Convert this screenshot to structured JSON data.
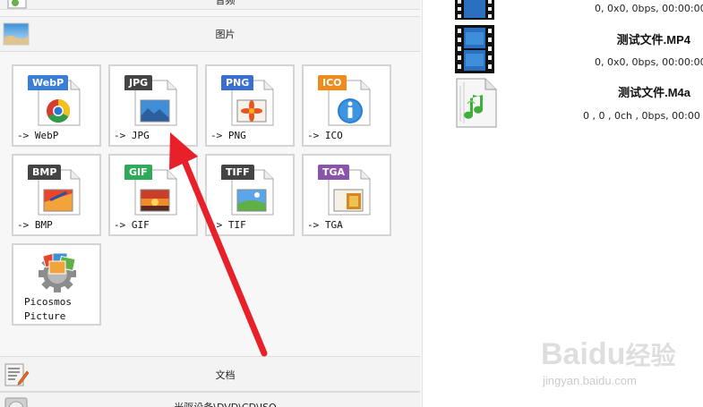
{
  "left_panel": {
    "top_category": {
      "label": "音频"
    },
    "images_category": {
      "label": "图片"
    },
    "docs_category": {
      "label": "文档"
    },
    "disc_category": {
      "label": "光驱设备\\DVD\\CD\\ISO"
    },
    "tiles": [
      {
        "badge": "WebP",
        "label": "-> WebP",
        "badge_color": "#3a7fd5"
      },
      {
        "badge": "JPG",
        "label": "-> JPG",
        "badge_color": "#444444"
      },
      {
        "badge": "PNG",
        "label": "-> PNG",
        "badge_color": "#3a6fd0"
      },
      {
        "badge": "ICO",
        "label": "-> ICO",
        "badge_color": "#ef8a1c"
      },
      {
        "badge": "BMP",
        "label": "-> BMP",
        "badge_color": "#444444"
      },
      {
        "badge": "GIF",
        "label": "-> GIF",
        "badge_color": "#2faa5a"
      },
      {
        "badge": "TIFF",
        "label": "-> TIF",
        "badge_color": "#444444"
      },
      {
        "badge": "TGA",
        "label": "-> TGA",
        "badge_color": "#8a55a8"
      }
    ],
    "picosmos": {
      "line1": "Picosmos",
      "line2": "Picture"
    }
  },
  "right_panel": {
    "files": [
      {
        "name": "",
        "meta": "0, 0x0, 0bps, 00:00:00",
        "icon": "film-icon"
      },
      {
        "name": "测试文件.MP4",
        "meta": "0, 0x0, 0bps, 00:00:00",
        "icon": "film-icon"
      },
      {
        "name": "测试文件.M4a",
        "meta": "0 , 0 , 0ch , 0bps, 00:00",
        "icon": "music-file-icon"
      }
    ]
  },
  "annotation": {
    "color": "#e8202a"
  },
  "watermark": {
    "brand": "Baidu",
    "brand_cn": "经验",
    "url": "jingyan.baidu.com"
  }
}
